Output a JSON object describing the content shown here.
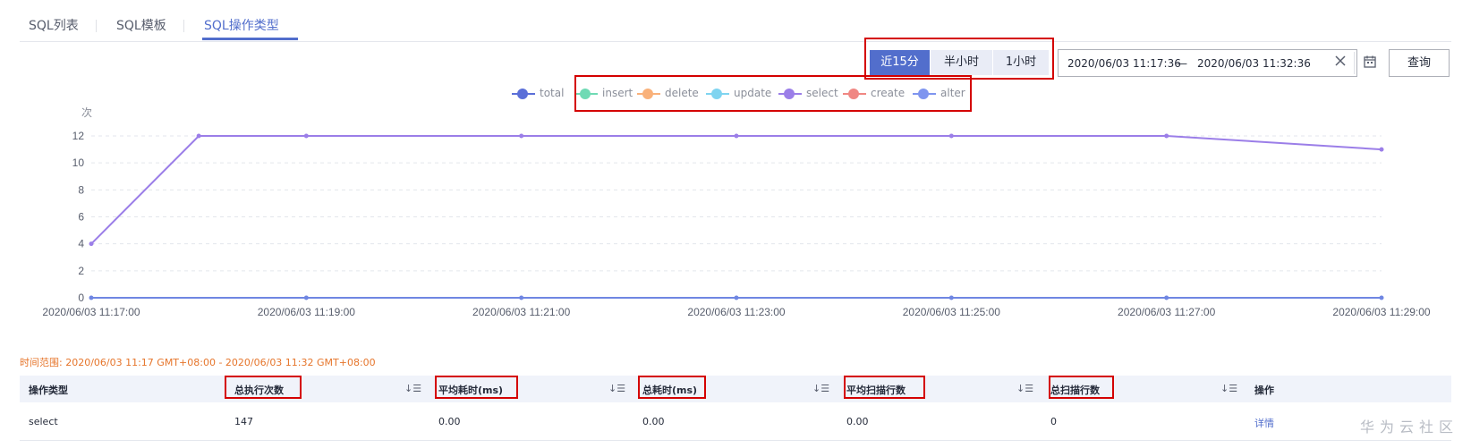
{
  "tabs": [
    {
      "label": "SQL列表"
    },
    {
      "label": "SQL模板"
    },
    {
      "label": "SQL操作类型"
    }
  ],
  "time_range_buttons": [
    {
      "label": "近15分"
    },
    {
      "label": "半小时"
    },
    {
      "label": "1小时"
    }
  ],
  "date_range": {
    "start": "2020/06/03 11:17:36",
    "separator": "—",
    "end": "2020/06/03 11:32:36"
  },
  "query_button": "查询",
  "chart_data": {
    "type": "line",
    "ylabel": "次",
    "ylim": [
      0,
      12
    ],
    "yticks": [
      "0",
      "2",
      "4",
      "6",
      "8",
      "10",
      "12"
    ],
    "x_tick_labels": [
      "2020/06/03 11:17:00",
      "2020/06/03 11:19:00",
      "2020/06/03 11:21:00",
      "2020/06/03 11:23:00",
      "2020/06/03 11:25:00",
      "2020/06/03 11:27:00",
      "2020/06/03 11:29:00"
    ],
    "x_minutes": [
      0,
      2,
      4,
      6,
      8,
      10,
      12
    ],
    "legend": [
      {
        "name": "total",
        "color": "#5b6fd8"
      },
      {
        "name": "insert",
        "color": "#6fdab4"
      },
      {
        "name": "delete",
        "color": "#f9b17a"
      },
      {
        "name": "update",
        "color": "#7fd4f0"
      },
      {
        "name": "select",
        "color": "#9b7ee8"
      },
      {
        "name": "create",
        "color": "#f08783"
      },
      {
        "name": "alter",
        "color": "#7f95ef"
      }
    ],
    "series": [
      {
        "name": "select",
        "color": "#9b7ee8",
        "x": [
          0,
          1,
          2,
          4,
          6,
          8,
          10,
          12
        ],
        "y": [
          4,
          12,
          12,
          12,
          12,
          12,
          12,
          11
        ]
      },
      {
        "name": "total",
        "color": "#6f86e2",
        "x": [
          0,
          2,
          4,
          6,
          8,
          10,
          12
        ],
        "y": [
          0,
          0,
          0,
          0,
          0,
          0,
          0
        ]
      }
    ]
  },
  "time_range_text": "时间范围: 2020/06/03 11:17 GMT+08:00 - 2020/06/03 11:32 GMT+08:00",
  "table": {
    "headers": [
      "操作类型",
      "总执行次数",
      "平均耗时(ms)",
      "总耗时(ms)",
      "平均扫描行数",
      "总扫描行数",
      "操作"
    ],
    "rows": [
      [
        "select",
        "147",
        "0.00",
        "0.00",
        "0.00",
        "0",
        "详情"
      ]
    ]
  },
  "watermark": "华为云社区"
}
